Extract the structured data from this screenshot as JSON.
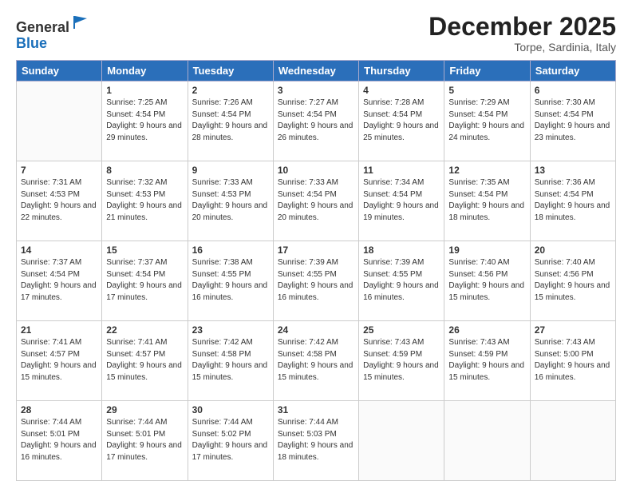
{
  "logo": {
    "general": "General",
    "blue": "Blue"
  },
  "title": "December 2025",
  "location": "Torpe, Sardinia, Italy",
  "days_of_week": [
    "Sunday",
    "Monday",
    "Tuesday",
    "Wednesday",
    "Thursday",
    "Friday",
    "Saturday"
  ],
  "weeks": [
    [
      {
        "day": "",
        "sunrise": "",
        "sunset": "",
        "daylight": ""
      },
      {
        "day": "1",
        "sunrise": "Sunrise: 7:25 AM",
        "sunset": "Sunset: 4:54 PM",
        "daylight": "Daylight: 9 hours and 29 minutes."
      },
      {
        "day": "2",
        "sunrise": "Sunrise: 7:26 AM",
        "sunset": "Sunset: 4:54 PM",
        "daylight": "Daylight: 9 hours and 28 minutes."
      },
      {
        "day": "3",
        "sunrise": "Sunrise: 7:27 AM",
        "sunset": "Sunset: 4:54 PM",
        "daylight": "Daylight: 9 hours and 26 minutes."
      },
      {
        "day": "4",
        "sunrise": "Sunrise: 7:28 AM",
        "sunset": "Sunset: 4:54 PM",
        "daylight": "Daylight: 9 hours and 25 minutes."
      },
      {
        "day": "5",
        "sunrise": "Sunrise: 7:29 AM",
        "sunset": "Sunset: 4:54 PM",
        "daylight": "Daylight: 9 hours and 24 minutes."
      },
      {
        "day": "6",
        "sunrise": "Sunrise: 7:30 AM",
        "sunset": "Sunset: 4:54 PM",
        "daylight": "Daylight: 9 hours and 23 minutes."
      }
    ],
    [
      {
        "day": "7",
        "sunrise": "Sunrise: 7:31 AM",
        "sunset": "Sunset: 4:53 PM",
        "daylight": "Daylight: 9 hours and 22 minutes."
      },
      {
        "day": "8",
        "sunrise": "Sunrise: 7:32 AM",
        "sunset": "Sunset: 4:53 PM",
        "daylight": "Daylight: 9 hours and 21 minutes."
      },
      {
        "day": "9",
        "sunrise": "Sunrise: 7:33 AM",
        "sunset": "Sunset: 4:53 PM",
        "daylight": "Daylight: 9 hours and 20 minutes."
      },
      {
        "day": "10",
        "sunrise": "Sunrise: 7:33 AM",
        "sunset": "Sunset: 4:54 PM",
        "daylight": "Daylight: 9 hours and 20 minutes."
      },
      {
        "day": "11",
        "sunrise": "Sunrise: 7:34 AM",
        "sunset": "Sunset: 4:54 PM",
        "daylight": "Daylight: 9 hours and 19 minutes."
      },
      {
        "day": "12",
        "sunrise": "Sunrise: 7:35 AM",
        "sunset": "Sunset: 4:54 PM",
        "daylight": "Daylight: 9 hours and 18 minutes."
      },
      {
        "day": "13",
        "sunrise": "Sunrise: 7:36 AM",
        "sunset": "Sunset: 4:54 PM",
        "daylight": "Daylight: 9 hours and 18 minutes."
      }
    ],
    [
      {
        "day": "14",
        "sunrise": "Sunrise: 7:37 AM",
        "sunset": "Sunset: 4:54 PM",
        "daylight": "Daylight: 9 hours and 17 minutes."
      },
      {
        "day": "15",
        "sunrise": "Sunrise: 7:37 AM",
        "sunset": "Sunset: 4:54 PM",
        "daylight": "Daylight: 9 hours and 17 minutes."
      },
      {
        "day": "16",
        "sunrise": "Sunrise: 7:38 AM",
        "sunset": "Sunset: 4:55 PM",
        "daylight": "Daylight: 9 hours and 16 minutes."
      },
      {
        "day": "17",
        "sunrise": "Sunrise: 7:39 AM",
        "sunset": "Sunset: 4:55 PM",
        "daylight": "Daylight: 9 hours and 16 minutes."
      },
      {
        "day": "18",
        "sunrise": "Sunrise: 7:39 AM",
        "sunset": "Sunset: 4:55 PM",
        "daylight": "Daylight: 9 hours and 16 minutes."
      },
      {
        "day": "19",
        "sunrise": "Sunrise: 7:40 AM",
        "sunset": "Sunset: 4:56 PM",
        "daylight": "Daylight: 9 hours and 15 minutes."
      },
      {
        "day": "20",
        "sunrise": "Sunrise: 7:40 AM",
        "sunset": "Sunset: 4:56 PM",
        "daylight": "Daylight: 9 hours and 15 minutes."
      }
    ],
    [
      {
        "day": "21",
        "sunrise": "Sunrise: 7:41 AM",
        "sunset": "Sunset: 4:57 PM",
        "daylight": "Daylight: 9 hours and 15 minutes."
      },
      {
        "day": "22",
        "sunrise": "Sunrise: 7:41 AM",
        "sunset": "Sunset: 4:57 PM",
        "daylight": "Daylight: 9 hours and 15 minutes."
      },
      {
        "day": "23",
        "sunrise": "Sunrise: 7:42 AM",
        "sunset": "Sunset: 4:58 PM",
        "daylight": "Daylight: 9 hours and 15 minutes."
      },
      {
        "day": "24",
        "sunrise": "Sunrise: 7:42 AM",
        "sunset": "Sunset: 4:58 PM",
        "daylight": "Daylight: 9 hours and 15 minutes."
      },
      {
        "day": "25",
        "sunrise": "Sunrise: 7:43 AM",
        "sunset": "Sunset: 4:59 PM",
        "daylight": "Daylight: 9 hours and 15 minutes."
      },
      {
        "day": "26",
        "sunrise": "Sunrise: 7:43 AM",
        "sunset": "Sunset: 4:59 PM",
        "daylight": "Daylight: 9 hours and 15 minutes."
      },
      {
        "day": "27",
        "sunrise": "Sunrise: 7:43 AM",
        "sunset": "Sunset: 5:00 PM",
        "daylight": "Daylight: 9 hours and 16 minutes."
      }
    ],
    [
      {
        "day": "28",
        "sunrise": "Sunrise: 7:44 AM",
        "sunset": "Sunset: 5:01 PM",
        "daylight": "Daylight: 9 hours and 16 minutes."
      },
      {
        "day": "29",
        "sunrise": "Sunrise: 7:44 AM",
        "sunset": "Sunset: 5:01 PM",
        "daylight": "Daylight: 9 hours and 17 minutes."
      },
      {
        "day": "30",
        "sunrise": "Sunrise: 7:44 AM",
        "sunset": "Sunset: 5:02 PM",
        "daylight": "Daylight: 9 hours and 17 minutes."
      },
      {
        "day": "31",
        "sunrise": "Sunrise: 7:44 AM",
        "sunset": "Sunset: 5:03 PM",
        "daylight": "Daylight: 9 hours and 18 minutes."
      },
      {
        "day": "",
        "sunrise": "",
        "sunset": "",
        "daylight": ""
      },
      {
        "day": "",
        "sunrise": "",
        "sunset": "",
        "daylight": ""
      },
      {
        "day": "",
        "sunrise": "",
        "sunset": "",
        "daylight": ""
      }
    ]
  ]
}
